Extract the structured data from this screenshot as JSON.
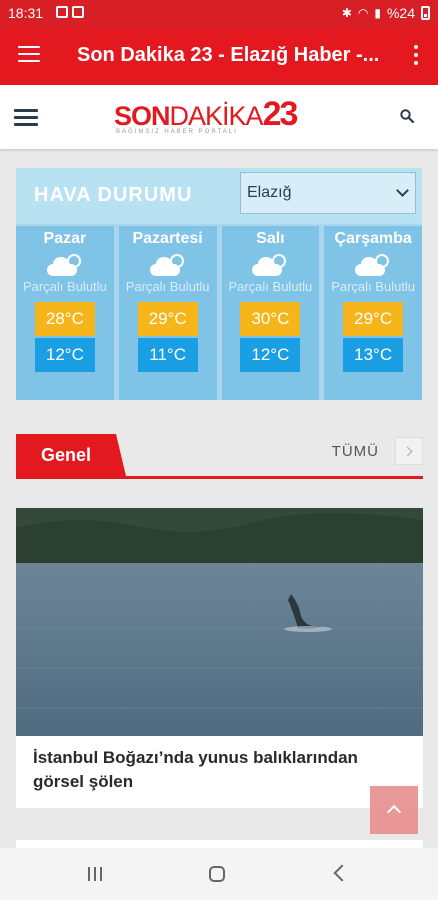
{
  "status": {
    "time": "18:31",
    "battery": "%24"
  },
  "appbar": {
    "title": "Son Dakika 23 - Elazığ Haber -..."
  },
  "logo": {
    "part1": "SON",
    "part2": "DAKİKA",
    "part3": "23",
    "tagline": "BAĞIMSIZ HABER PORTALI"
  },
  "weather": {
    "title": "HAVA DURUMU",
    "city": "Elazığ",
    "days": [
      {
        "name": "Pazar",
        "desc": "Parçalı Bulutlu",
        "high": "28°C",
        "low": "12°C"
      },
      {
        "name": "Pazartesi",
        "desc": "Parçalı Bulutlu",
        "high": "29°C",
        "low": "11°C"
      },
      {
        "name": "Salı",
        "desc": "Parçalı Bulutlu",
        "high": "30°C",
        "low": "12°C"
      },
      {
        "name": "Çarşamba",
        "desc": "Parçalı Bulutlu",
        "high": "29°C",
        "low": "13°C"
      }
    ]
  },
  "section": {
    "tab": "Genel",
    "all": "TÜMÜ"
  },
  "news": [
    {
      "title": "İstanbul Boğazı’nda yunus balıklarından görsel şölen"
    }
  ],
  "colors": {
    "brand": "#e3191f",
    "high": "#f6b51b",
    "low": "#1a9fe4"
  }
}
